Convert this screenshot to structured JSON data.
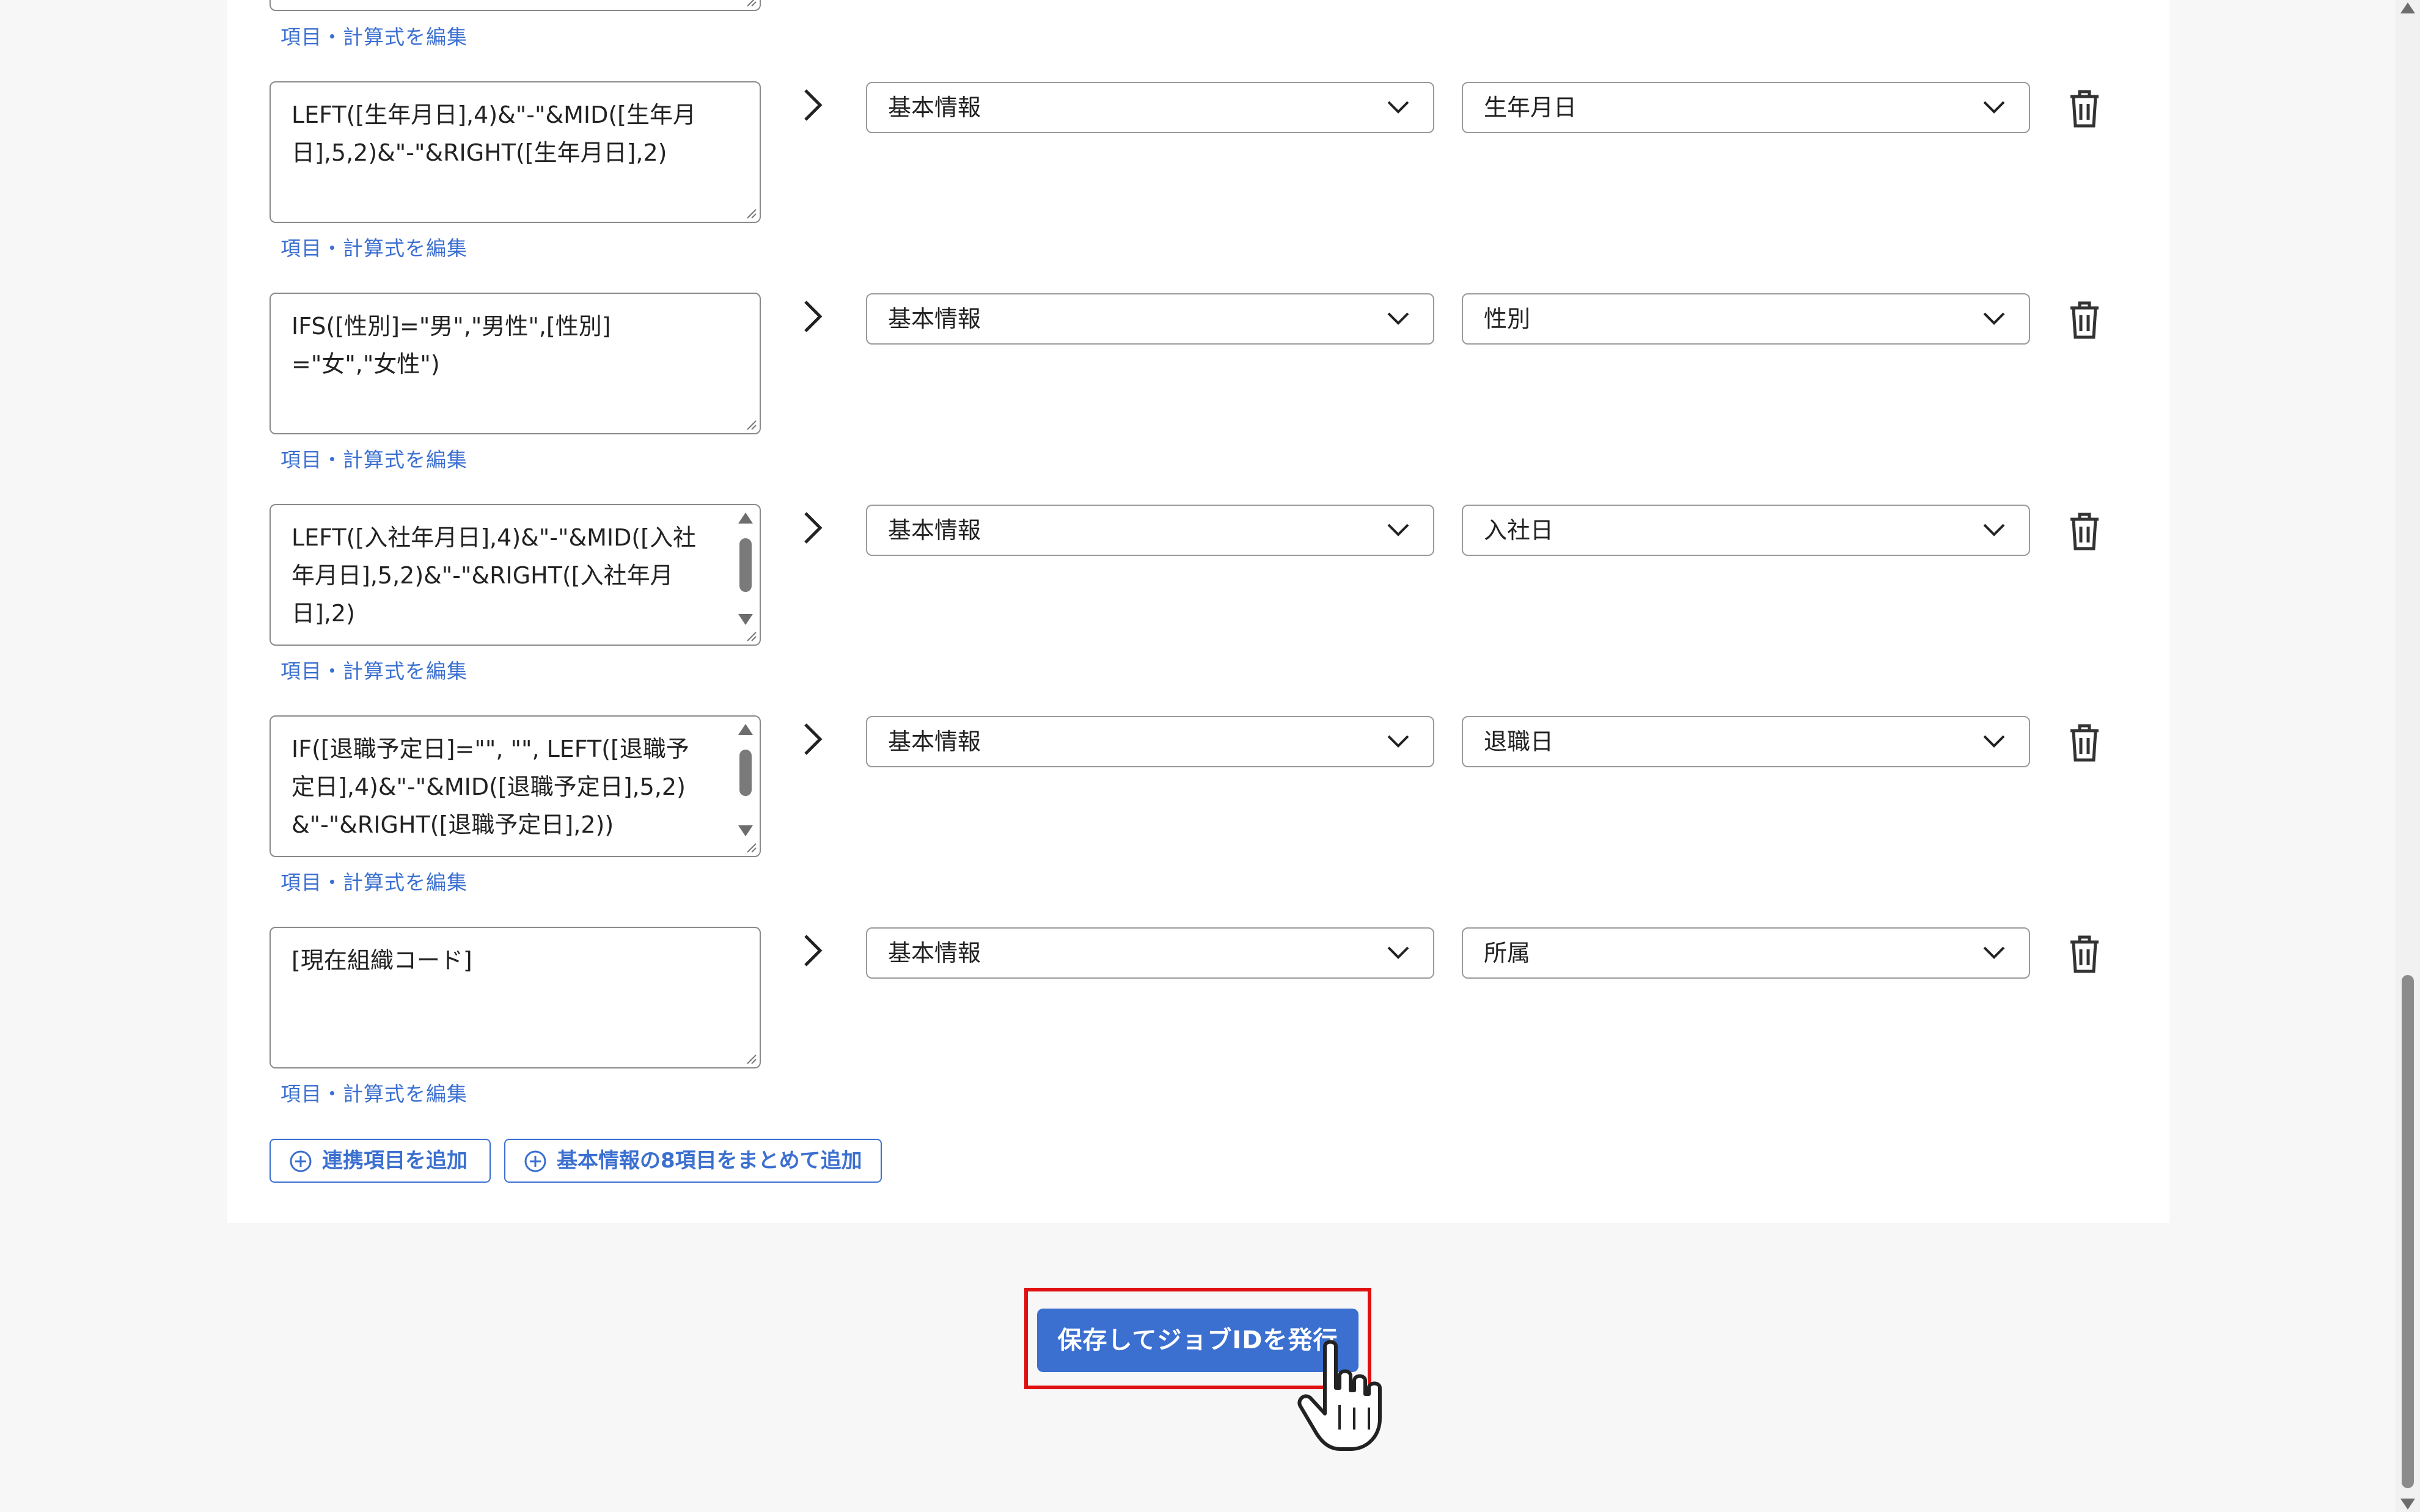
{
  "rows": [
    {
      "formula": "LEFT([生年月日],4)&\"-\"&MID([生年月日],5,2)&\"-\"&RIGHT([生年月日],2)",
      "category": "基本情報",
      "field": "生年月日",
      "edit_link": "項目・計算式を編集"
    },
    {
      "formula": "IFS([性別]=\"男\",\"男性\",[性別]=\"女\",\"女性\")",
      "category": "基本情報",
      "field": "性別",
      "edit_link": "項目・計算式を編集"
    },
    {
      "formula": "LEFT([入社年月日],4)&\"-\"&MID([入社年月日],5,2)&\"-\"&RIGHT([入社年月日],2)",
      "category": "基本情報",
      "field": "入社日",
      "edit_link": "項目・計算式を編集"
    },
    {
      "formula": "IF([退職予定日]=\"\", \"\", LEFT([退職予定日],4)&\"-\"&MID([退職予定日],5,2)&\"-\"&RIGHT([退職予定日],2))",
      "category": "基本情報",
      "field": "退職日",
      "edit_link": "項目・計算式を編集"
    },
    {
      "formula": "[現在組織コード]",
      "category": "基本情報",
      "field": "所属",
      "edit_link": "項目・計算式を編集"
    }
  ],
  "top_edit_link": "項目・計算式を編集",
  "buttons": {
    "add_item": "連携項目を追加",
    "add_bulk": "基本情報の8項目をまとめて追加",
    "save": "保存してジョブIDを発行"
  },
  "colors": {
    "accent": "#3b6fd0",
    "highlight": "#e01010"
  }
}
